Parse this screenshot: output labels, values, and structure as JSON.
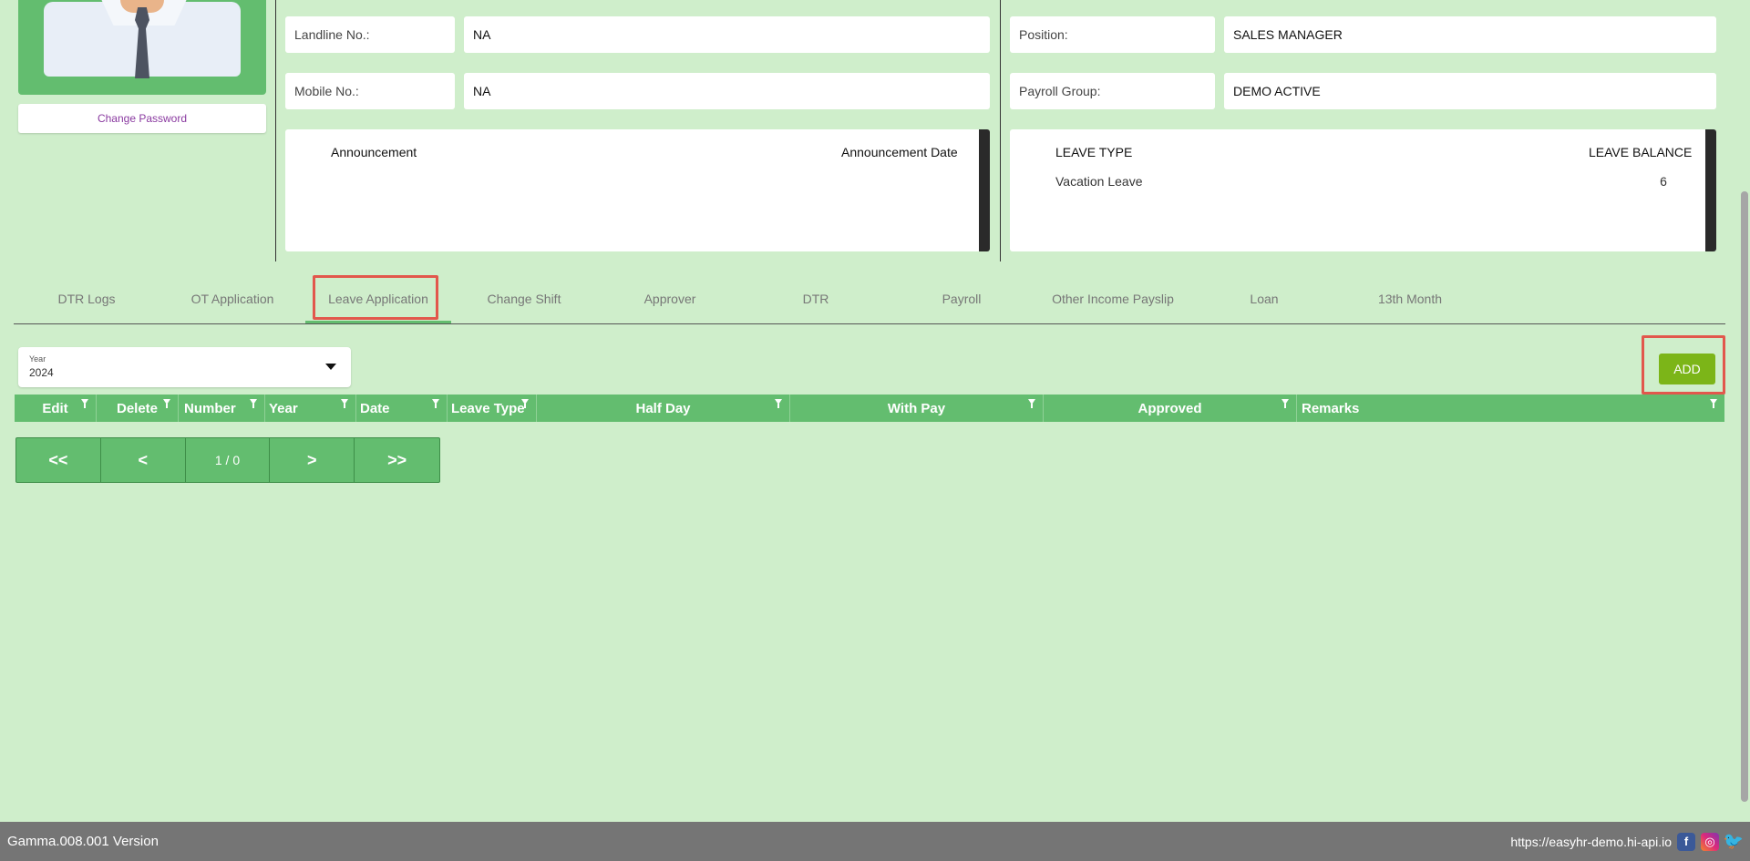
{
  "profile": {
    "change_password_label": "Change Password"
  },
  "contact": {
    "landline_label": "Landline No.:",
    "landline_value": "NA",
    "mobile_label": "Mobile No.:",
    "mobile_value": "NA"
  },
  "job": {
    "position_label": "Position:",
    "position_value": "SALES MANAGER",
    "payroll_group_label": "Payroll Group:",
    "payroll_group_value": "DEMO ACTIVE"
  },
  "announcements": {
    "col_announcement": "Announcement",
    "col_date": "Announcement Date"
  },
  "leave_balance": {
    "col_type": "LEAVE TYPE",
    "col_balance": "LEAVE BALANCE",
    "rows": [
      {
        "type": "Vacation Leave",
        "balance": "6"
      }
    ]
  },
  "tabs": [
    {
      "label": "DTR Logs"
    },
    {
      "label": "OT Application"
    },
    {
      "label": "Leave Application",
      "active": true
    },
    {
      "label": "Change Shift"
    },
    {
      "label": "Approver"
    },
    {
      "label": "DTR"
    },
    {
      "label": "Payroll"
    },
    {
      "label": "Other Income Payslip"
    },
    {
      "label": "Loan"
    },
    {
      "label": "13th Month"
    }
  ],
  "filter": {
    "year_label": "Year",
    "year_value": "2024"
  },
  "toolbar": {
    "add_label": "ADD"
  },
  "grid": {
    "columns": [
      "Edit",
      "Delete",
      "Number",
      "Year",
      "Date",
      "Leave Type",
      "Half Day",
      "With Pay",
      "Approved",
      "Remarks"
    ],
    "rows": []
  },
  "pager": {
    "first": "<<",
    "prev": "<",
    "info": "1 / 0",
    "next": ">",
    "last": ">>"
  },
  "footer": {
    "version": "Gamma.008.001 Version",
    "url": "https://easyhr-demo.hi-api.io",
    "social": [
      "facebook-icon",
      "instagram-icon",
      "twitter-icon"
    ]
  },
  "colors": {
    "background": "#cfeecb",
    "accent_green": "#63bd6f",
    "add_button": "#7cb518",
    "highlight_border": "#e2574c",
    "footer": "#757575"
  }
}
